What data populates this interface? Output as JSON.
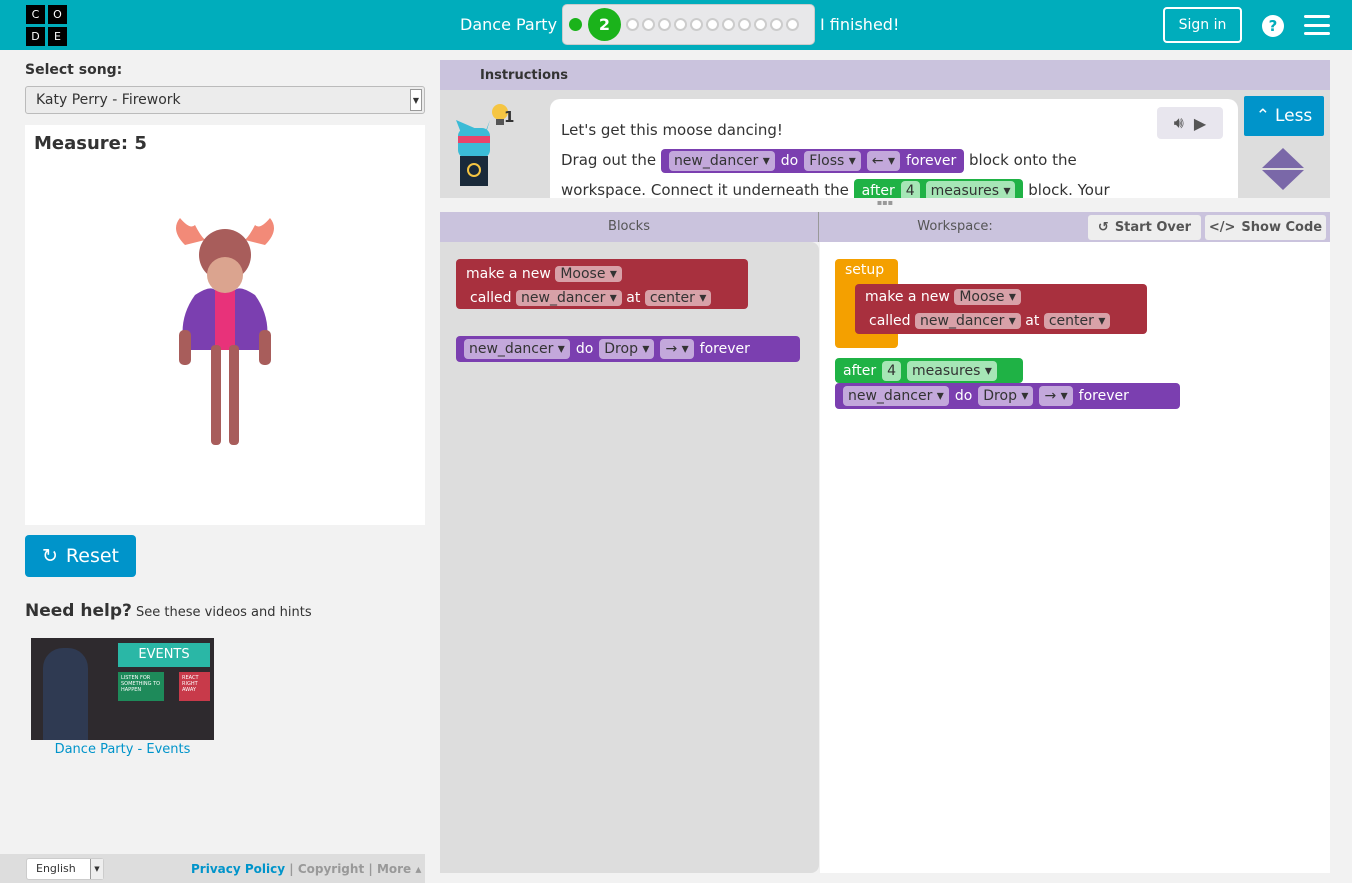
{
  "header": {
    "logo": [
      "C",
      "O",
      "D",
      "E"
    ],
    "title": "Dance Party",
    "current_level": "2",
    "total_levels": 13,
    "finished_label": "I finished!",
    "sign_in": "Sign in",
    "help_icon": "?"
  },
  "left": {
    "select_label": "Select song:",
    "song": "Katy Perry - Firework",
    "measure": "Measure: 5",
    "reset": "Reset",
    "help_title": "Need help?",
    "help_sub": "See these videos and hints",
    "video_title": "Dance Party - Events",
    "video_text": {
      "events": "EVENTS",
      "listen": "LISTEN FOR SOMETHING TO HAPPEN",
      "react": "REACT RIGHT AWAY"
    }
  },
  "footer": {
    "language": "English",
    "privacy": "Privacy Policy",
    "copyright": "Copyright",
    "more": "More"
  },
  "instructions": {
    "header": "Instructions",
    "hint_count": "1",
    "line1": "Let's get this moose dancing!",
    "drag": "Drag out the",
    "onto": "block onto the",
    "connect": "workspace. Connect it underneath the",
    "your": "block. Your",
    "less": "Less"
  },
  "blocks": {
    "new_dancer": "new_dancer",
    "do": "do",
    "floss": "Floss",
    "left_arrow": "←",
    "right_arrow": "→",
    "forever": "forever",
    "after": "after",
    "four": "4",
    "measures": "measures",
    "make_a_new": "make a new",
    "moose": "Moose",
    "called": "called",
    "at": "at",
    "center": "center",
    "drop": "Drop",
    "setup": "setup"
  },
  "workspace": {
    "blocks_label": "Blocks",
    "workspace_label": "Workspace:",
    "start_over": "Start Over",
    "show_code": "Show Code"
  },
  "colors": {
    "header": "#00adbc",
    "accent": "#0094ca",
    "sprite_block": "#a8303e",
    "dance_block": "#7b3fb0",
    "event_block": "#1fb245",
    "setup_block": "#f4a000"
  }
}
